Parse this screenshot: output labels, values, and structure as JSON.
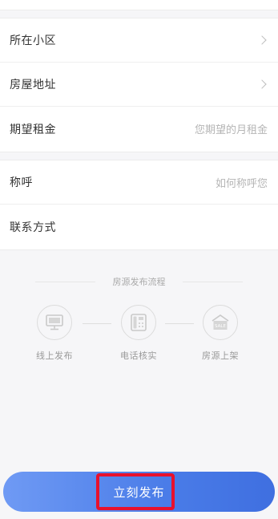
{
  "form": {
    "community_label": "所在小区",
    "address_label": "房屋地址",
    "rent_label": "期望租金",
    "rent_placeholder": "您期望的月租金",
    "name_label": "称呼",
    "name_placeholder": "如何称呼您",
    "contact_label": "联系方式"
  },
  "process": {
    "title": "房源发布流程",
    "steps": [
      {
        "label": "线上发布",
        "icon": "monitor-icon"
      },
      {
        "label": "电话核实",
        "icon": "telephone-icon"
      },
      {
        "label": "房源上架",
        "icon": "sale-house-icon"
      }
    ],
    "sale_icon_text": "SALE"
  },
  "publish": {
    "label": "立刻发布",
    "gradient_start": "#6f9af4",
    "gradient_end": "#3f6fe0"
  },
  "highlight_color": "#e8112d"
}
